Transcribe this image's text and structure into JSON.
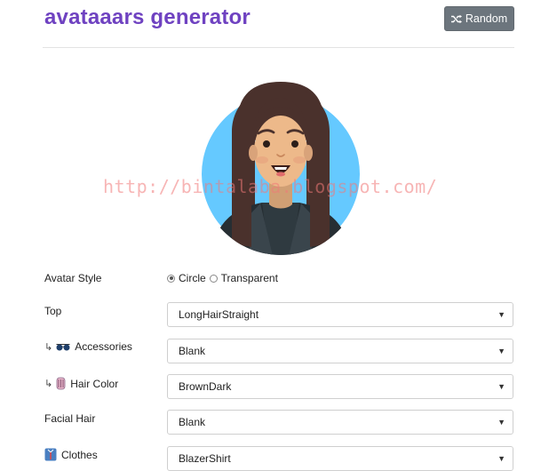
{
  "header": {
    "title": "avataaars generator",
    "random_label": "Random"
  },
  "watermark": "http://bintalaba.blogspot.com/",
  "form": {
    "avatar_style": {
      "label": "Avatar Style",
      "options": [
        "Circle",
        "Transparent"
      ],
      "selected": "Circle"
    },
    "top": {
      "label": "Top",
      "value": "LongHairStraight"
    },
    "accessories": {
      "label": "Accessories",
      "icon": "sunglasses-icon",
      "value": "Blank"
    },
    "hair_color": {
      "label": "Hair Color",
      "icon": "hair-icon",
      "value": "BrownDark"
    },
    "facial_hair": {
      "label": "Facial Hair",
      "value": "Blank"
    },
    "clothes": {
      "label": "Clothes",
      "icon": "shirt-icon",
      "value": "BlazerShirt"
    }
  },
  "colors": {
    "title": "#6f42c1",
    "button": "#6c757d",
    "avatar_bg": "#65c9ff",
    "hair": "#4a312c",
    "skin": "#edb98a",
    "blazer": "#262e33",
    "shirt": "#2f3a40"
  }
}
